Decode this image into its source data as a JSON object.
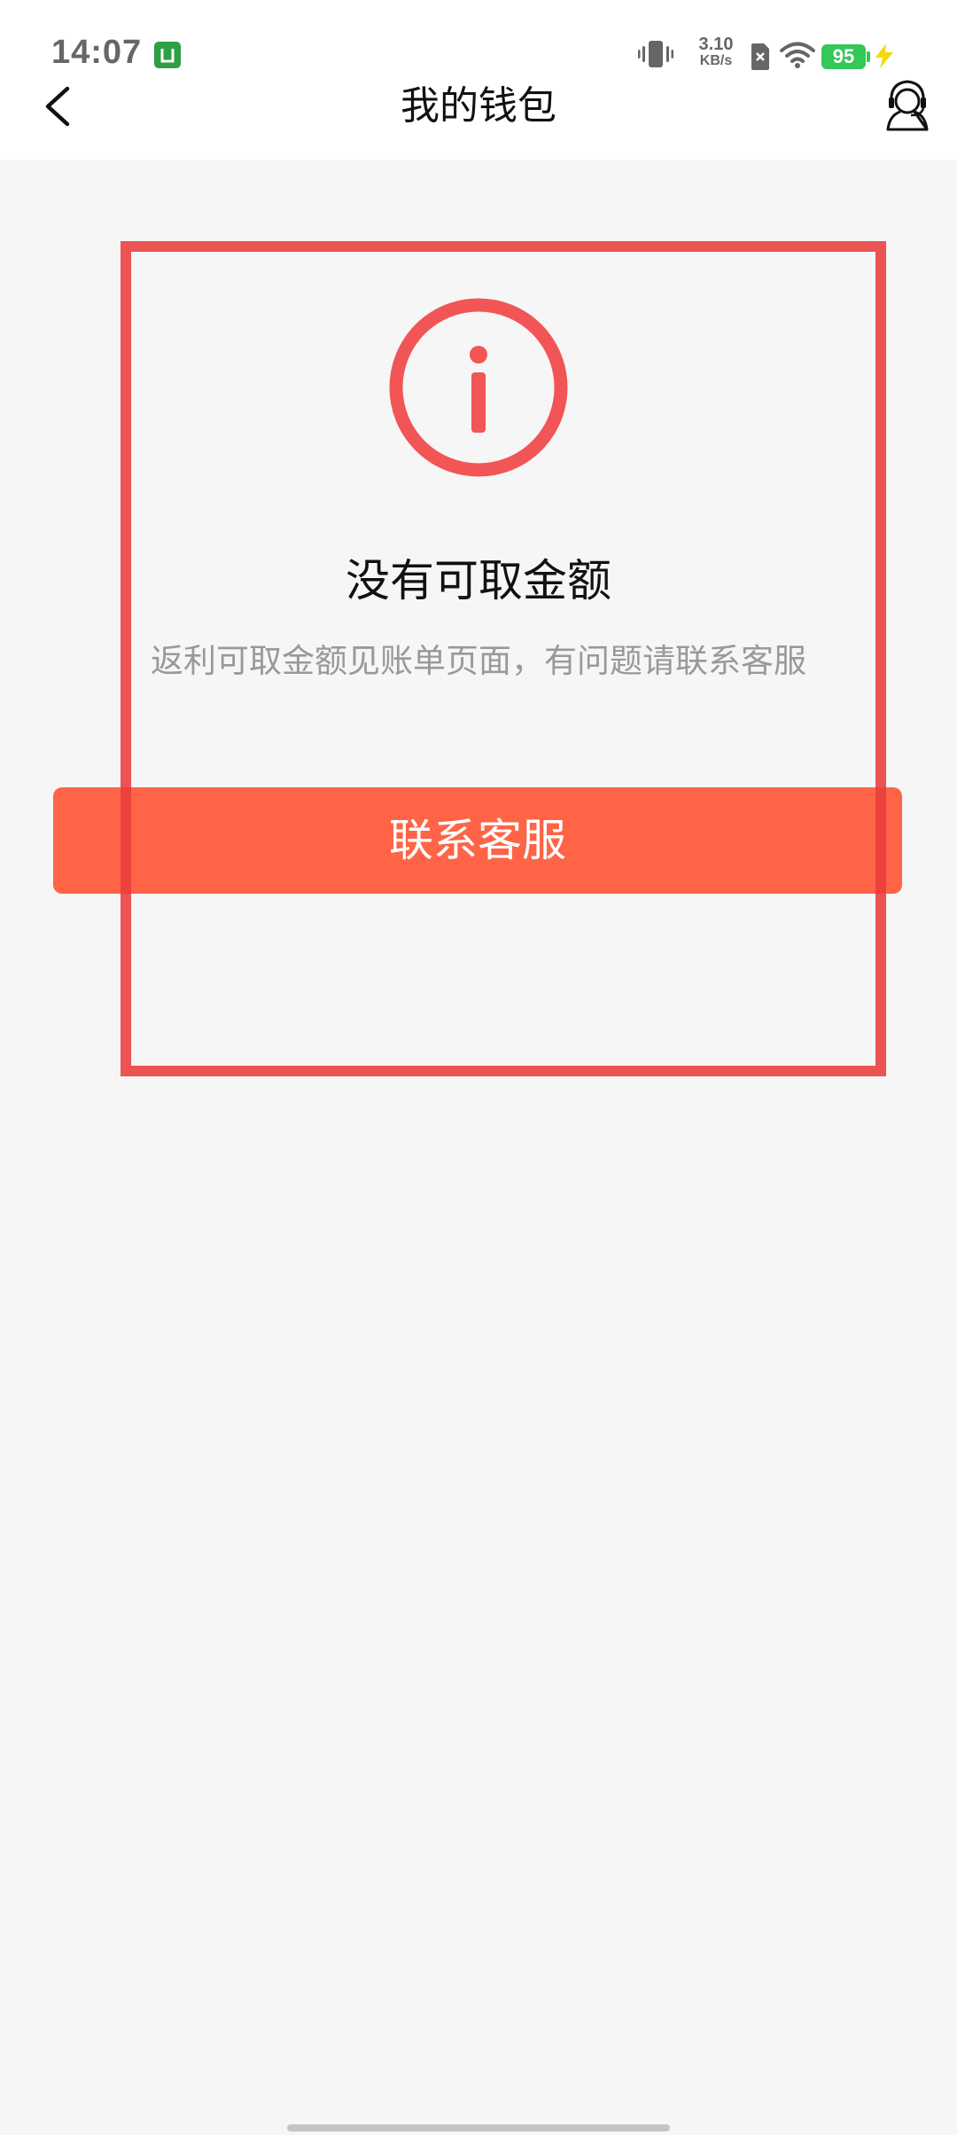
{
  "status_bar": {
    "time": "14:07",
    "net_speed_value": "3.10",
    "net_speed_unit": "KB/s",
    "battery_level": "95",
    "icons": [
      "app-badge-icon",
      "vibrate-icon",
      "no-sim-icon",
      "wifi-icon",
      "battery-icon",
      "charging-icon"
    ]
  },
  "nav": {
    "title": "我的钱包",
    "back_icon": "chevron-left-icon",
    "service_icon": "customer-service-icon"
  },
  "empty_state": {
    "icon": "info-icon",
    "title": "没有可取金额",
    "description": "返利可取金额见账单页面，有问题请联系客服",
    "button_label": "联系客服"
  },
  "colors": {
    "accent": "#ff6446",
    "info_icon": "#f25555",
    "highlight": "#eb3c3c",
    "background": "#f6f6f6",
    "battery": "#34c759"
  }
}
